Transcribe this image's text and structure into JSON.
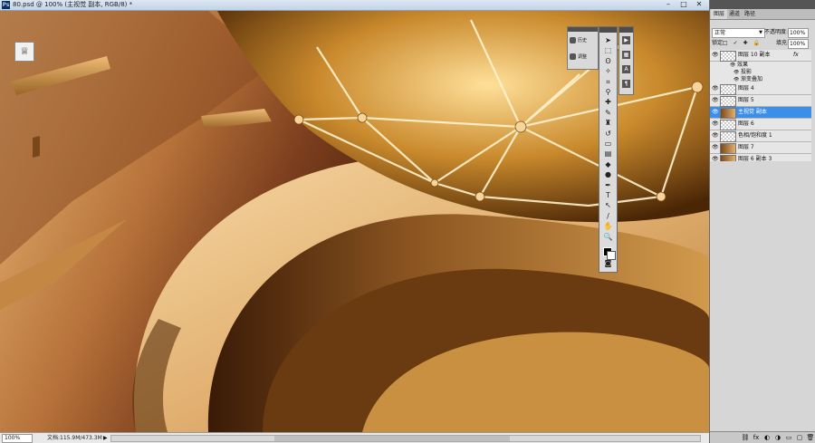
{
  "document": {
    "title": "80.psd @ 100% (主视觉 副本, RGB/8) *",
    "app_icon": "Ps"
  },
  "window_buttons": {
    "minimize": "–",
    "maximize": "□",
    "close": "✕"
  },
  "status_bar": {
    "zoom": "100%",
    "doc_size": "文档:115.9M/473.3M",
    "arrow": "▶"
  },
  "mini_panel": {
    "items": [
      {
        "label": "历史",
        "icon": "history-icon"
      },
      {
        "label": "调整",
        "icon": "adjust-icon"
      }
    ]
  },
  "toolbox": {
    "tools": [
      {
        "name": "move-tool-icon",
        "glyph": "➤"
      },
      {
        "name": "marquee-tool-icon",
        "glyph": "⬚"
      },
      {
        "name": "lasso-tool-icon",
        "glyph": "ʘ"
      },
      {
        "name": "magic-wand-tool-icon",
        "glyph": "✧"
      },
      {
        "name": "crop-tool-icon",
        "glyph": "⌗"
      },
      {
        "name": "eyedropper-tool-icon",
        "glyph": "⚲"
      },
      {
        "name": "healing-brush-tool-icon",
        "glyph": "✚"
      },
      {
        "name": "brush-tool-icon",
        "glyph": "✎"
      },
      {
        "name": "clone-stamp-tool-icon",
        "glyph": "♜"
      },
      {
        "name": "history-brush-tool-icon",
        "glyph": "↺"
      },
      {
        "name": "eraser-tool-icon",
        "glyph": "▭"
      },
      {
        "name": "gradient-tool-icon",
        "glyph": "▤"
      },
      {
        "name": "blur-tool-icon",
        "glyph": "◆"
      },
      {
        "name": "dodge-tool-icon",
        "glyph": "●"
      },
      {
        "name": "pen-tool-icon",
        "glyph": "✒"
      },
      {
        "name": "type-tool-icon",
        "glyph": "T"
      },
      {
        "name": "path-selection-tool-icon",
        "glyph": "↖"
      },
      {
        "name": "shape-tool-icon",
        "glyph": "/"
      },
      {
        "name": "hand-tool-icon",
        "glyph": "✋"
      },
      {
        "name": "zoom-tool-icon",
        "glyph": "🔍"
      }
    ],
    "quick_mask_glyph": "◙"
  },
  "side_strip": {
    "buttons": [
      {
        "name": "actions-panel-icon",
        "glyph": "▶"
      },
      {
        "name": "swatches-panel-icon",
        "glyph": "▦"
      },
      {
        "name": "character-panel-icon",
        "glyph": "A"
      },
      {
        "name": "paragraph-panel-icon",
        "glyph": "¶"
      }
    ]
  },
  "layers_panel": {
    "tabs": [
      "图层",
      "通道",
      "路径"
    ],
    "blend_mode": "正常",
    "opacity_label": "不透明度:",
    "opacity": "100%",
    "lock_label": "锁定:",
    "lock_icons": "□ ✓ ✚ 🔒",
    "fill_label": "填充:",
    "fill": "100%",
    "layers": [
      {
        "name": "图层 10 副本",
        "fx": "fx",
        "thumb": "checker",
        "selected": false,
        "eye": "👁",
        "effects_label": "效果",
        "effects": [
          "投影",
          "渐变叠加"
        ]
      },
      {
        "name": "图层 4",
        "fx": "",
        "thumb": "checker",
        "selected": false,
        "eye": "👁"
      },
      {
        "name": "图层 5",
        "fx": "",
        "thumb": "checker",
        "selected": false,
        "eye": "👁"
      },
      {
        "name": "主视觉 副本",
        "fx": "",
        "thumb": "img",
        "selected": true,
        "eye": "👁"
      },
      {
        "name": "图层 6",
        "fx": "",
        "thumb": "checker",
        "selected": false,
        "eye": "👁"
      },
      {
        "name": "色相/饱和度 1",
        "fx": "",
        "thumb": "adjust",
        "selected": false,
        "eye": "👁"
      },
      {
        "name": "图层 7",
        "fx": "",
        "thumb": "img",
        "selected": false,
        "eye": "👁"
      },
      {
        "name": "图层 6 副本 3",
        "fx": "",
        "thumb": "img",
        "selected": false,
        "eye": "👁"
      }
    ],
    "bottom_buttons": [
      "⛓",
      "fx",
      "◐",
      "◑",
      "▭",
      "▢",
      "🗑"
    ]
  },
  "colors": {
    "accent_selection": "#3d8ee8",
    "gold_light": "#f0c27a",
    "gold_dark": "#5a2e0e"
  }
}
